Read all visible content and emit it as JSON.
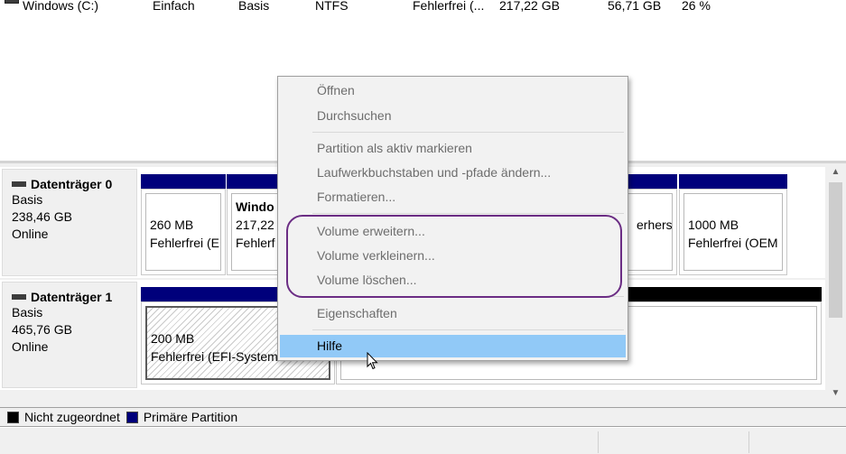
{
  "volume_list": {
    "row": {
      "name": "Windows (C:)",
      "layout": "Einfach",
      "type": "Basis",
      "filesystem": "NTFS",
      "status": "Fehlerfrei (...",
      "capacity": "217,22 GB",
      "free": "56,71 GB",
      "percent_free": "26 %"
    }
  },
  "disks": [
    {
      "title": "Datenträger 0",
      "kind": "Basis",
      "size": "238,46 GB",
      "state": "Online",
      "partitions": [
        {
          "line1": "260 MB",
          "line2": "Fehlerfrei (E"
        },
        {
          "line1": "Windo",
          "line2": "217,22",
          "line3": "Fehlerf"
        },
        {
          "line1": "",
          "line2": "erherst"
        },
        {
          "line1": "1000 MB",
          "line2": "Fehlerfrei (OEM"
        }
      ]
    },
    {
      "title": "Datenträger 1",
      "kind": "Basis",
      "size": "465,76 GB",
      "state": "Online",
      "partitions": [
        {
          "line1": "200 MB",
          "line2": "Fehlerfrei (EFI-System"
        }
      ]
    }
  ],
  "legend": {
    "unallocated": "Nicht zugeordnet",
    "primary": "Primäre Partition",
    "unallocated_color": "#000000",
    "primary_color": "#00007b"
  },
  "context_menu": {
    "items": [
      {
        "label": "Öffnen"
      },
      {
        "label": "Durchsuchen"
      },
      {
        "label": "Partition als aktiv markieren"
      },
      {
        "label": "Laufwerkbuchstaben und -pfade ändern..."
      },
      {
        "label": "Formatieren..."
      },
      {
        "label": "Volume erweitern..."
      },
      {
        "label": "Volume verkleinern..."
      },
      {
        "label": "Volume löschen..."
      },
      {
        "label": "Eigenschaften"
      },
      {
        "label": "Hilfe"
      }
    ],
    "highlight_color": "#91c9f7",
    "annotation_color": "#6b2d84"
  }
}
